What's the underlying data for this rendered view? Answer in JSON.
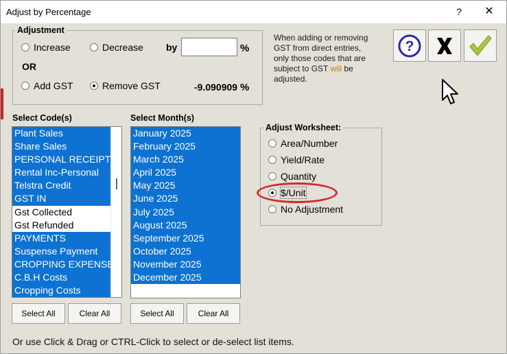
{
  "window": {
    "title": "Adjust by Percentage",
    "help_glyph": "?",
    "close_glyph": "✕"
  },
  "adjustment": {
    "group_label": "Adjustment",
    "increase_label": "Increase",
    "decrease_label": "Decrease",
    "by_label": "by",
    "by_value": "",
    "percent_sign": "%",
    "or_label": "OR",
    "add_gst_label": "Add GST",
    "remove_gst_label": "Remove GST",
    "gst_value": "-9.090909",
    "gst_percent_sign": "%",
    "selected_option": "Remove GST"
  },
  "info": {
    "text_line1": "When adding or removing GST from direct entries, only those codes that are subject to GST ",
    "text_highlight": "will",
    "text_line2": " be adjusted."
  },
  "toolbar": {
    "help_icon": "question-circle-icon",
    "cancel_icon": "x-icon",
    "ok_icon": "checkmark-icon"
  },
  "codes": {
    "label": "Select Code(s)",
    "items": [
      {
        "label": "Plant Sales",
        "selected": true
      },
      {
        "label": "Share Sales",
        "selected": true
      },
      {
        "label": "PERSONAL RECEIPTS",
        "selected": true
      },
      {
        "label": "Rental Inc-Personal",
        "selected": true
      },
      {
        "label": "Telstra Credit",
        "selected": true
      },
      {
        "label": "GST IN",
        "selected": true
      },
      {
        "label": "Gst Collected",
        "selected": false
      },
      {
        "label": "Gst Refunded",
        "selected": false
      },
      {
        "label": "PAYMENTS",
        "selected": true
      },
      {
        "label": "Suspense Payment",
        "selected": true
      },
      {
        "label": "CROPPING EXPENSES",
        "selected": true
      },
      {
        "label": "C.B.H Costs",
        "selected": true
      },
      {
        "label": "Cropping Costs",
        "selected": true
      }
    ],
    "select_all_label": "Select All",
    "clear_all_label": "Clear All"
  },
  "months": {
    "label": "Select Month(s)",
    "items": [
      {
        "label": "January 2025",
        "selected": true
      },
      {
        "label": "February 2025",
        "selected": true
      },
      {
        "label": "March 2025",
        "selected": true
      },
      {
        "label": "April 2025",
        "selected": true
      },
      {
        "label": "May 2025",
        "selected": true
      },
      {
        "label": "June 2025",
        "selected": true
      },
      {
        "label": "July 2025",
        "selected": true
      },
      {
        "label": "August 2025",
        "selected": true
      },
      {
        "label": "September 2025",
        "selected": true
      },
      {
        "label": "October 2025",
        "selected": true
      },
      {
        "label": "November 2025",
        "selected": true
      },
      {
        "label": "December 2025",
        "selected": true
      }
    ],
    "select_all_label": "Select All",
    "clear_all_label": "Clear All"
  },
  "worksheet": {
    "group_label": "Adjust Worksheet:",
    "options": [
      "Area/Number",
      "Yield/Rate",
      "Quantity",
      "$/Unit",
      "No Adjustment"
    ],
    "selected": "$/Unit"
  },
  "footer": {
    "text": "Or use Click & Drag or CTRL-Click to select or de-select list items."
  },
  "colors": {
    "selection": "#0d72d1",
    "dialog_bg": "#e3e0d8",
    "annotation_ring": "#d32a2a",
    "help_icon": "#2a2a9c",
    "ok_check": "#9fc43a"
  }
}
